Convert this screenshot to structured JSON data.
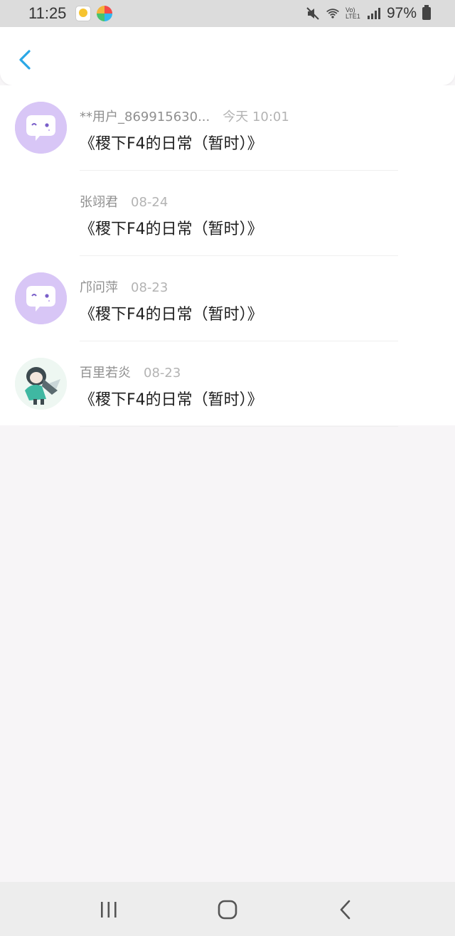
{
  "status_bar": {
    "time": "11:25",
    "battery_percent": "97%",
    "network_label": "Vo) LTE1"
  },
  "header": {
    "back_icon": "chevron-left-icon",
    "accent_color": "#2aa7e6"
  },
  "items": [
    {
      "username": "**用户_869915630...",
      "timestamp": "今天 10:01",
      "text": "《稷下F4的日常（暂时）》",
      "avatar": "purple-emoji-avatar"
    },
    {
      "username": "张翊君",
      "timestamp": "08-24",
      "text": "《稷下F4的日常（暂时）》",
      "avatar": "none"
    },
    {
      "username": "邝问萍",
      "timestamp": "08-23",
      "text": "《稷下F4的日常（暂时）》",
      "avatar": "purple-emoji-avatar"
    },
    {
      "username": "百里若炎",
      "timestamp": "08-23",
      "text": "《稷下F4的日常（暂时）》",
      "avatar": "character-art-avatar"
    }
  ],
  "nav": {
    "recent_icon": "recent-apps-icon",
    "home_icon": "home-icon",
    "back_icon": "back-icon"
  }
}
